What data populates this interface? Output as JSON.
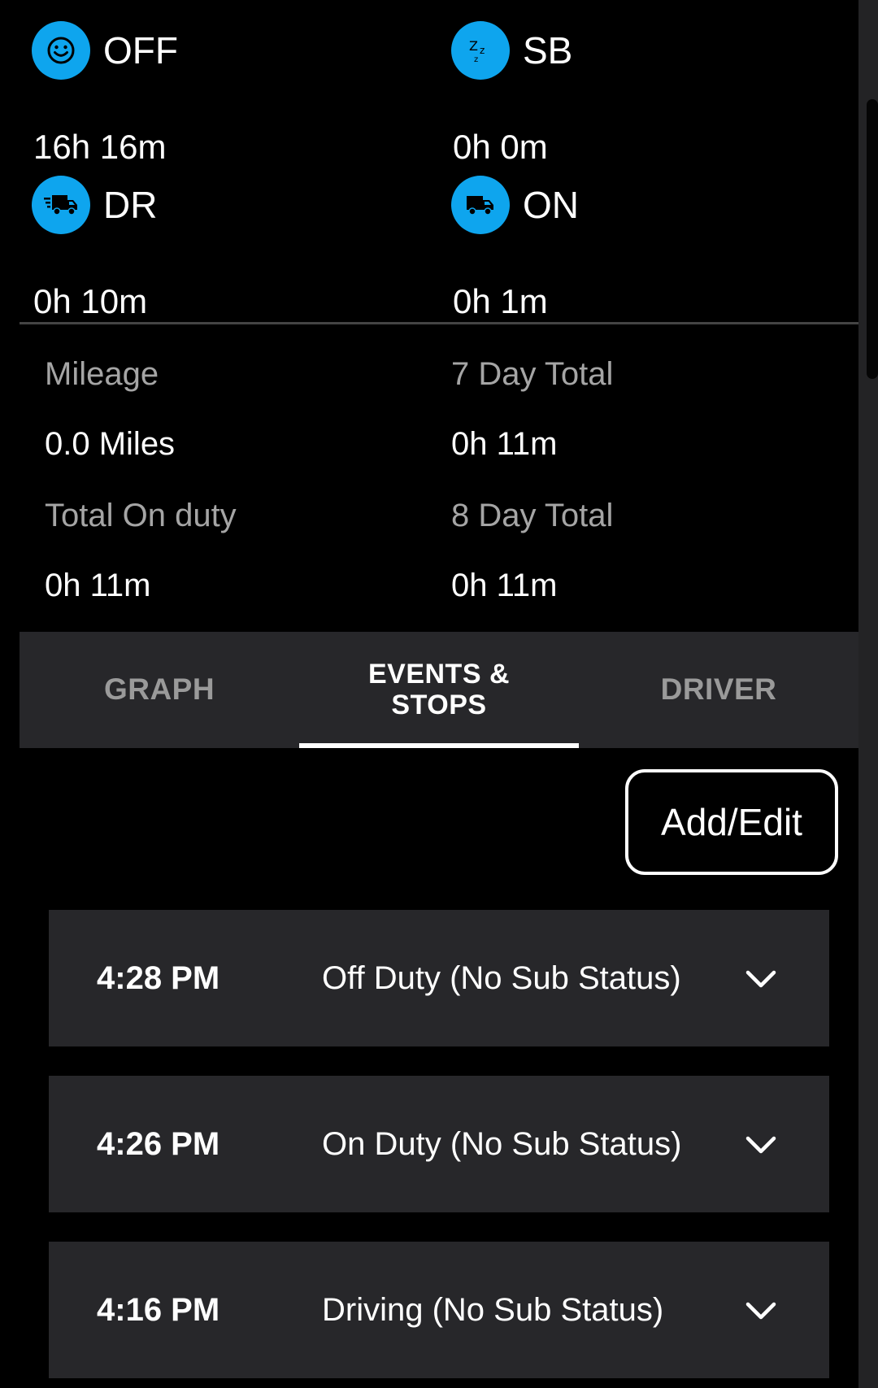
{
  "statuses": [
    {
      "code": "OFF",
      "time": "16h 16m",
      "icon": "smiley-icon"
    },
    {
      "code": "SB",
      "time": "0h 0m",
      "icon": "sleep-zzz-icon"
    },
    {
      "code": "DR",
      "time": "0h 10m",
      "icon": "moving-truck-icon"
    },
    {
      "code": "ON",
      "time": "0h 1m",
      "icon": "truck-icon"
    }
  ],
  "summary": {
    "mileage_label": "Mileage",
    "mileage_value": "0.0 Miles",
    "seven_day_label": "7 Day Total",
    "seven_day_value": "0h 11m",
    "on_duty_label": "Total On duty",
    "on_duty_value": "0h 11m",
    "eight_day_label": "8 Day Total",
    "eight_day_value": "0h 11m"
  },
  "tabs": {
    "graph": "GRAPH",
    "events_line1": "EVENTS &",
    "events_line2": "STOPS",
    "driver": "DRIVER",
    "active": "EVENTS & STOPS"
  },
  "add_edit_label": "Add/Edit",
  "events": [
    {
      "time": "4:28 PM",
      "status": "Off Duty (No Sub Status)"
    },
    {
      "time": "4:26 PM",
      "status": "On Duty (No Sub Status)"
    },
    {
      "time": "4:16 PM",
      "status": "Driving (No Sub Status)"
    }
  ],
  "colors": {
    "accent": "#0ea5ee",
    "background": "#000000",
    "surface": "#27272a",
    "muted_text": "#a5a5a5"
  }
}
